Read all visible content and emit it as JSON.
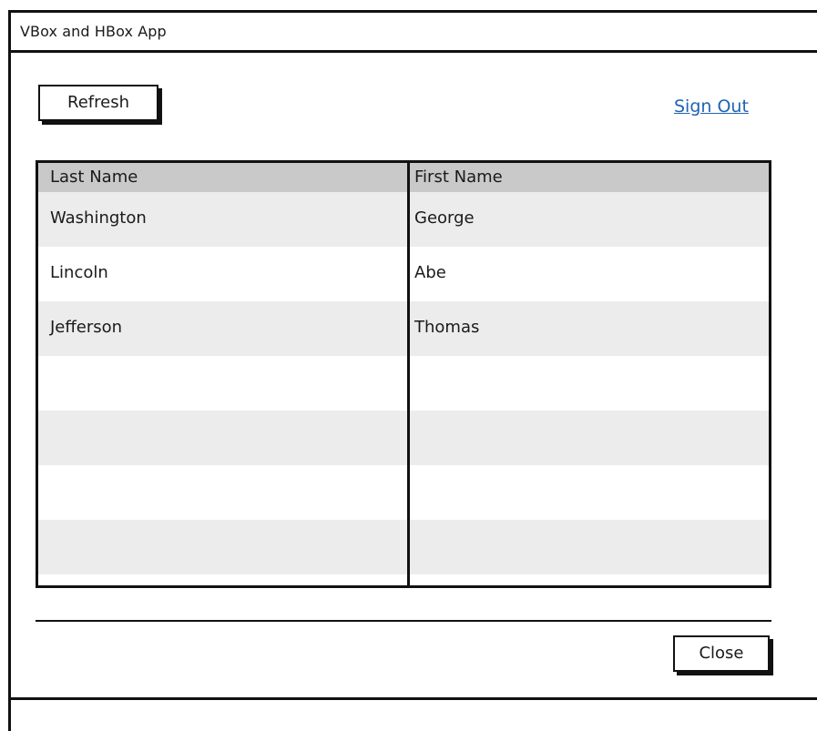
{
  "window": {
    "title": "VBox and HBox App"
  },
  "toolbar": {
    "refresh_label": "Refresh",
    "signout_label": "Sign Out"
  },
  "table": {
    "columns": [
      "Last Name",
      "First Name"
    ],
    "rows": [
      [
        "Washington",
        "George"
      ],
      [
        "Lincoln",
        "Abe"
      ],
      [
        "Jefferson",
        "Thomas"
      ],
      [
        "",
        ""
      ],
      [
        "",
        ""
      ],
      [
        "",
        ""
      ],
      [
        "",
        ""
      ]
    ]
  },
  "footer": {
    "close_label": "Close"
  },
  "colors": {
    "link": "#2064b0",
    "header_bg": "#c9c9c9",
    "row_alt_bg": "#ececec",
    "border": "#111111"
  }
}
